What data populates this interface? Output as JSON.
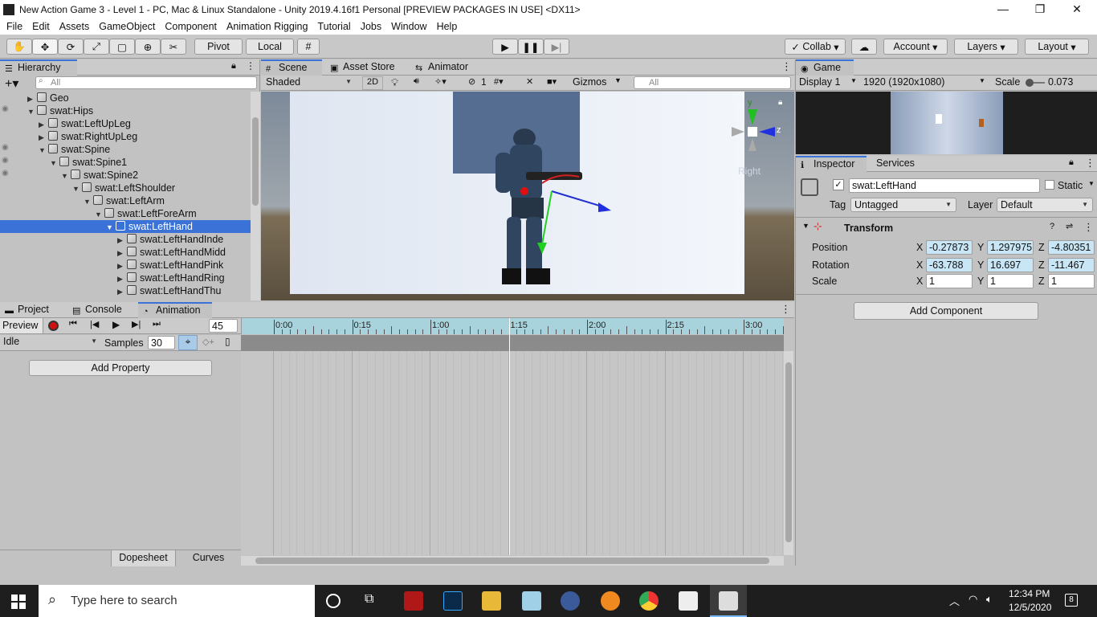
{
  "window": {
    "title": "New Action Game 3 - Level 1 - PC, Mac & Linux Standalone - Unity 2019.4.16f1 Personal [PREVIEW PACKAGES IN USE] <DX11>",
    "minimize": "—",
    "restore": "❐",
    "close": "✕"
  },
  "menu": [
    "File",
    "Edit",
    "Assets",
    "GameObject",
    "Component",
    "Animation Rigging",
    "Tutorial",
    "Jobs",
    "Window",
    "Help"
  ],
  "toolbar": {
    "pivot": "Pivot",
    "local": "Local",
    "collab": "Collab",
    "account": "Account",
    "layers": "Layers",
    "layout": "Layout"
  },
  "hierarchy": {
    "tab": "Hierarchy",
    "search_placeholder": "All",
    "items": [
      {
        "label": "Geo",
        "depth": 2,
        "arrow": "▶"
      },
      {
        "label": "swat:Hips",
        "depth": 2,
        "arrow": "▼"
      },
      {
        "label": "swat:LeftUpLeg",
        "depth": 3,
        "arrow": "▶"
      },
      {
        "label": "swat:RightUpLeg",
        "depth": 3,
        "arrow": "▶"
      },
      {
        "label": "swat:Spine",
        "depth": 3,
        "arrow": "▼"
      },
      {
        "label": "swat:Spine1",
        "depth": 4,
        "arrow": "▼"
      },
      {
        "label": "swat:Spine2",
        "depth": 5,
        "arrow": "▼"
      },
      {
        "label": "swat:LeftShoulder",
        "depth": 6,
        "arrow": "▼"
      },
      {
        "label": "swat:LeftArm",
        "depth": 7,
        "arrow": "▼"
      },
      {
        "label": "swat:LeftForeArm",
        "depth": 8,
        "arrow": "▼"
      },
      {
        "label": "swat:LeftHand",
        "depth": 9,
        "arrow": "▼",
        "selected": true
      },
      {
        "label": "swat:LeftHandInde",
        "depth": 10,
        "arrow": "▶"
      },
      {
        "label": "swat:LeftHandMidd",
        "depth": 10,
        "arrow": "▶"
      },
      {
        "label": "swat:LeftHandPink",
        "depth": 10,
        "arrow": "▶"
      },
      {
        "label": "swat:LeftHandRing",
        "depth": 10,
        "arrow": "▶"
      },
      {
        "label": "swat:LeftHandThu",
        "depth": 10,
        "arrow": "▶"
      }
    ]
  },
  "scene": {
    "tabs": [
      "Scene",
      "Asset Store",
      "Animator"
    ],
    "shading": "Shaded",
    "two_d": "2D",
    "hidden_count": "1",
    "gizmos": "Gizmos",
    "search_placeholder": "All",
    "axis_y": "y",
    "axis_z": "z",
    "view_label": "Right"
  },
  "game": {
    "tab": "Game",
    "display": "Display 1",
    "resolution": "1920 (1920x1080)",
    "scale_label": "Scale",
    "scale_value": "0.073"
  },
  "inspector": {
    "tabs": [
      "Inspector",
      "Services"
    ],
    "object_name": "swat:LeftHand",
    "static_label": "Static",
    "tag_label": "Tag",
    "tag_value": "Untagged",
    "layer_label": "Layer",
    "layer_value": "Default",
    "transform_title": "Transform",
    "position_label": "Position",
    "rotation_label": "Rotation",
    "scale_label": "Scale",
    "position": {
      "x": "-0.27873",
      "y": "1.297975",
      "z": "-4.80351"
    },
    "rotation": {
      "x": "-63.788",
      "y": "16.697",
      "z": "-11.467"
    },
    "scale": {
      "x": "1",
      "y": "1",
      "z": "1"
    },
    "add_component": "Add Component"
  },
  "bottom": {
    "tabs": [
      "Project",
      "Console",
      "Animation"
    ],
    "preview": "Preview",
    "frame": "45",
    "clip": "Idle",
    "samples_label": "Samples",
    "samples_value": "30",
    "add_property": "Add Property",
    "dopesheet": "Dopesheet",
    "curves": "Curves",
    "time_labels": [
      "0:00",
      "0:15",
      "1:00",
      "1:15",
      "2:00",
      "2:15",
      "3:00"
    ]
  },
  "taskbar": {
    "search_placeholder": "Type here to search",
    "time": "12:34 PM",
    "date": "12/5/2020",
    "notifications": "8"
  },
  "colors": {
    "accent": "#3a72d8",
    "panel": "#c2c2c2",
    "taskbar": "#1e1e1e"
  }
}
